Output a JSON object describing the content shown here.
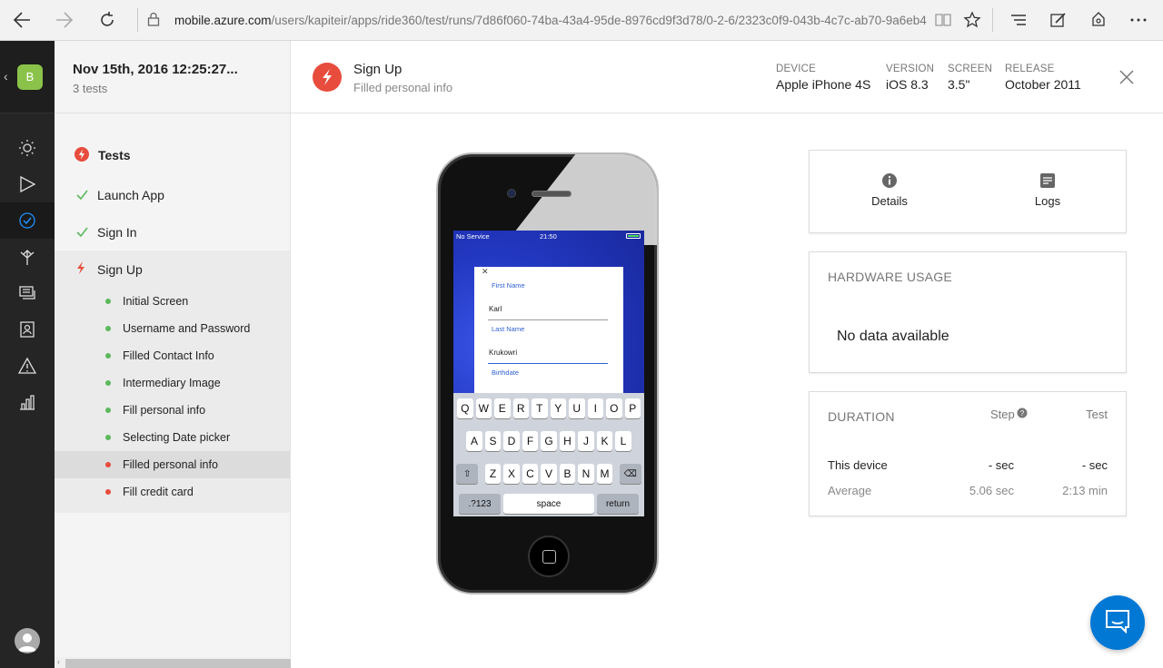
{
  "browser": {
    "url_host": "mobile.azure.com",
    "url_path": "/users/kapiteir/apps/ride360/test/runs/7d86f060-74ba-43a4-95de-8976cd9f3d78/0-2-6/2323c0f9-043b-4c7c-ab70-9a6eb4"
  },
  "app": {
    "badge": "B"
  },
  "run": {
    "title": "Nov 15th, 2016 12:25:27...",
    "subtitle": "3 tests"
  },
  "tests": {
    "heading": "Tests",
    "items": [
      {
        "label": "Launch App",
        "status": "passed"
      },
      {
        "label": "Sign In",
        "status": "passed"
      },
      {
        "label": "Sign Up",
        "status": "failed"
      }
    ],
    "steps": [
      {
        "label": "Initial Screen",
        "status": "passed"
      },
      {
        "label": "Username and Password",
        "status": "passed"
      },
      {
        "label": "Filled Contact Info",
        "status": "passed"
      },
      {
        "label": "Intermediary Image",
        "status": "passed"
      },
      {
        "label": "Fill personal info",
        "status": "passed"
      },
      {
        "label": "Selecting Date picker",
        "status": "passed"
      },
      {
        "label": "Filled personal info",
        "status": "failed"
      },
      {
        "label": "Fill credit card",
        "status": "failed"
      }
    ]
  },
  "step": {
    "title": "Sign Up",
    "subtitle": "Filled personal info"
  },
  "device_meta": {
    "device_label": "DEVICE",
    "device_value": "Apple iPhone 4S",
    "version_label": "VERSION",
    "version_value": "iOS 8.3",
    "screen_label": "SCREEN",
    "screen_value": "3.5\"",
    "release_label": "RELEASE",
    "release_value": "October 2011"
  },
  "phone_screen": {
    "carrier": "No Service",
    "time": "21:50",
    "first_name_label": "First Name",
    "first_name_value": "Karl",
    "last_name_label": "Last Name",
    "last_name_value": "Krukowri",
    "birthdate_label": "Birthdate",
    "keyboard_row1": [
      "Q",
      "W",
      "E",
      "R",
      "T",
      "Y",
      "U",
      "I",
      "O",
      "P"
    ],
    "keyboard_row2": [
      "A",
      "S",
      "D",
      "F",
      "G",
      "H",
      "J",
      "K",
      "L"
    ],
    "keyboard_row3": [
      "Z",
      "X",
      "C",
      "V",
      "B",
      "N",
      "M"
    ],
    "key_numbers": ".?123",
    "key_space": "space",
    "key_return": "return"
  },
  "tabs": {
    "details": "Details",
    "logs": "Logs"
  },
  "hardware": {
    "heading": "HARDWARE USAGE",
    "empty": "No data available"
  },
  "duration": {
    "heading": "DURATION",
    "col_step": "Step",
    "col_test": "Test",
    "rows": [
      {
        "label": "This device",
        "step": "- sec",
        "test": "- sec"
      },
      {
        "label": "Average",
        "step": "5.06 sec",
        "test": "2:13 min"
      }
    ]
  },
  "colors": {
    "pass": "#5cb85c",
    "fail": "#e74c3c",
    "accent": "#0078d4"
  }
}
